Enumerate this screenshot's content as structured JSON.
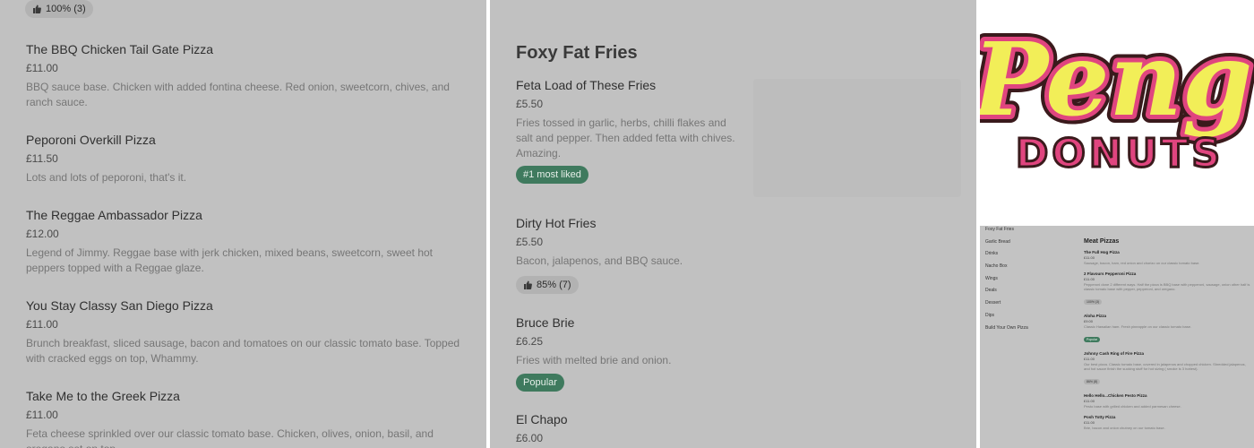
{
  "left": {
    "top_rating": "100% (3)",
    "items": [
      {
        "name": "The BBQ Chicken Tail Gate Pizza",
        "price": "£11.00",
        "desc": "BBQ sauce base. Chicken with added fontina cheese. Red onion, sweetcorn, chives, and ranch sauce."
      },
      {
        "name": "Peporoni Overkill Pizza",
        "price": "£11.50",
        "desc": "Lots and lots of peporoni, that's it."
      },
      {
        "name": "The Reggae Ambassador Pizza",
        "price": "£12.00",
        "desc": "Legend of Jimmy. Reggae base with jerk chicken, mixed beans, sweetcorn, sweet hot peppers topped with a Reggae glaze."
      },
      {
        "name": "You Stay Classy San Diego Pizza",
        "price": "£11.00",
        "desc": "Brunch breakfast, sliced sausage, bacon and tomatoes on our classic tomato base. Topped with cracked eggs on top, Whammy."
      },
      {
        "name": "Take Me to the Greek Pizza",
        "price": "£11.00",
        "desc": "Feta cheese sprinkled over our classic tomato base. Chicken, olives, onion, basil, and oregano set on top."
      }
    ]
  },
  "middle": {
    "section_title": "Foxy Fat Fries",
    "items": [
      {
        "name": "Feta Load of These Fries",
        "price": "£5.50",
        "desc": "Fries tossed in garlic, herbs, chilli flakes and salt and pepper. Then added fetta with chives. Amazing.",
        "tag": "#1 most liked"
      },
      {
        "name": "Dirty Hot Fries",
        "price": "£5.50",
        "desc": "Bacon, jalapenos, and BBQ sauce.",
        "rating": "85% (7)"
      },
      {
        "name": "Bruce Brie",
        "price": "£6.25",
        "desc": "Fries with melted brie and onion.",
        "tag": "Popular"
      },
      {
        "name": "El Chapo",
        "price": "£6.00"
      }
    ]
  },
  "logo": {
    "line1": "Peng",
    "line2": "DONUTS"
  },
  "mini": {
    "sidebar": [
      "Foxy Fat Fries",
      "Garlic Bread",
      "Drinks",
      "Nacho Box",
      "Wings",
      "Deals",
      "Dessert",
      "Dips",
      "Build Your Own Pizza"
    ],
    "section_title": "Meat Pizzas",
    "items": [
      {
        "name": "The Full Hog Pizza",
        "price": "£11.00",
        "desc": "Sausage, bacon, ham, red onion and chorizo on our classic tomato base."
      },
      {
        "name": "2 Flavours Pepperoni Pizza",
        "price": "£11.00",
        "desc": "Pepperoni done 2 different ways. Half the pizza is BBQ base with pepperoni, sausage, onion other half is classic tomato base with pepper, pepperoni, and oregano.",
        "rating": "100% (3)"
      },
      {
        "name": "Aloha Pizza",
        "price": "£9.00",
        "desc": "Classic Hawaiian ham. Fresh pineapple on our classic tomato base.",
        "tag": "Popular"
      },
      {
        "name": "Johnny Cash Ring of Fire Pizza",
        "price": "£11.00",
        "desc": "Our best pizza. Classic tomato base, covered in jalapenos and chopped chicken. Shredded jalapenos, and hot sauce finish the sucking stuff for hot sizing ( smoke is 3 hottest).",
        "rating": "86% (8)"
      },
      {
        "name": "Hello Hello...Chicken Pesto Pizza",
        "price": "£11.00",
        "desc": "Pesto base with grilled chicken and added parmesan cheese."
      },
      {
        "name": "Posh Totty Pizza",
        "price": "£11.00",
        "desc": "Brie, bacon and onion chutney on our tomato base."
      }
    ]
  },
  "colors": {
    "panel_bg": "#c1c1c1",
    "tag_green": "#3f7a5e",
    "logo_yellow": "#f2ee58",
    "logo_pink": "#e0457f",
    "logo_dark": "#3a1a1c"
  }
}
